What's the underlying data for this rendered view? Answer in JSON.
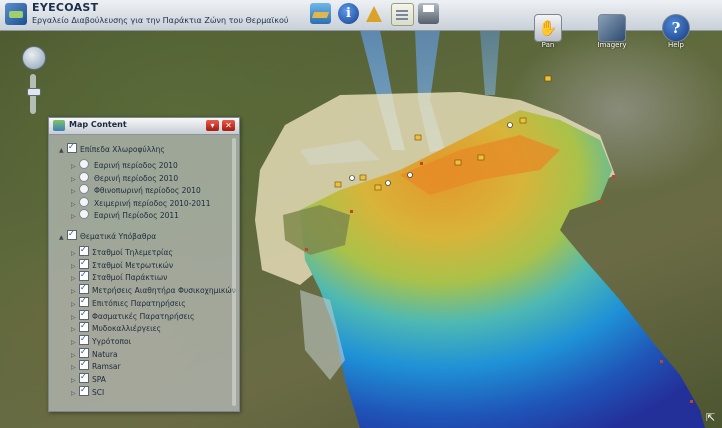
{
  "header": {
    "title": "EYECOAST",
    "subtitle": "Εργαλείο Διαβούλευσης για την Παράκτια Ζώνη του Θερμαϊκού"
  },
  "toolbar": {
    "icons": [
      "layers-icon",
      "info-icon",
      "measure-icon",
      "notes-icon",
      "print-icon"
    ]
  },
  "tools": {
    "pan": "Pan",
    "imagery": "Imagery",
    "help": "Help"
  },
  "panel": {
    "title": "Map Content",
    "minimize_symbol": "▾",
    "close_symbol": "✕",
    "group1": {
      "label": "Επίπεδα Χλωροφύλλης",
      "checked": true,
      "items": [
        "Εαρινή περίοδος 2010",
        "Θερινή περίοδος 2010",
        "Φθινοπωρινή περίοδος 2010",
        "Χειμερινή περίοδος 2010-2011",
        "Εαρινή Περίοδος 2011"
      ]
    },
    "group2": {
      "label": "Θεματικά Υπόβαθρα",
      "checked": true,
      "items": [
        "Σταθμοί Τηλεμετρίας",
        "Σταθμοί Μετρωτικών",
        "Σταθμοί Παράκτιων",
        "Μετρήσεις Αιαθητήρα Φυσικοχημικών",
        "Επιτόπιες Παρατηρήσεις",
        "Φασματικές Παρατηρήσεις",
        "Μυδοκαλλιέργειες",
        "Υγρότοποι",
        "Natura",
        "Ramsar",
        "SPA",
        "SCI"
      ]
    }
  },
  "colors": {
    "sea_deep": "#1f3fa8",
    "sea_mid": "#1e8ed8",
    "chlorophyll_high": "#e09a2a",
    "chlorophyll_mid": "#c9c240",
    "coastal_zone": "#efe6c0"
  }
}
